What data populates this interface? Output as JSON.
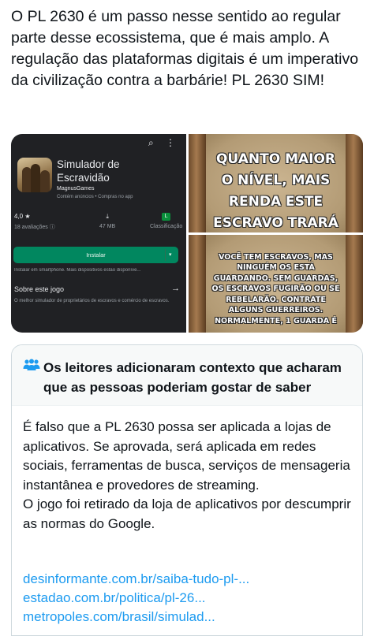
{
  "tweet": {
    "text": "O PL 2630 é um passo nesse sentido ao regular parte desse ecossistema, que é mais amplo. A regulação das plataformas digitais é um imperativo da civilização contra a barbárie! PL 2630 SIM!"
  },
  "media": {
    "playstore": {
      "app_title": "Simulador de Escravidão",
      "developer": "MagnusGames",
      "note": "Contém anúncios • Compras no app",
      "rating_value": "4,0 ★",
      "rating_label": "18 avaliações ⓘ",
      "size_value": "47 MB",
      "classification_badge": "L",
      "classification_label": "Classificação",
      "install_label": "Instalar",
      "availability": "Instalar em smartphone. Mais dispositivos estão disponíve...",
      "about_heading": "Sobre este jogo",
      "about_text": "O melhor simulador de proprietários de escravos e comércio de escravos."
    },
    "panel_top_text": "QUANTO MAIOR O NÍVEL, MAIS RENDA ESTE ESCRAVO TRARÁ",
    "panel_bottom_text": "VOCÊ TEM ESCRAVOS, MAS NINGUÉM OS ESTÁ GUARDANDO. SEM GUARDAS, OS ESCRAVOS FUGIRÃO OU SE REBELARÃO. CONTRATE ALGUNS GUERREIROS. NORMALMENTE, 1 GUARDA É"
  },
  "community_note": {
    "title": "Os leitores adicionaram contexto que acharam que as pessoas poderiam gostar de saber",
    "body_p1": "É falso que a PL 2630 possa ser aplicada a lojas de aplicativos. Se aprovada, será aplicada em redes sociais, ferramentas de busca, serviços de mensageria instantânea e provedores de streaming.",
    "body_p2": "O jogo foi retirado da loja de aplicativos por descumprir as normas do Google.",
    "links": [
      "desinformante.com.br/saiba-tudo-pl-...",
      "estadao.com.br/politica/pl-26...",
      "metropoles.com/brasil/simulad..."
    ]
  },
  "colors": {
    "link": "#1d9bf0",
    "install_green": "#01875f",
    "playstore_bg": "#202124",
    "note_header_bg": "#f7f9f9"
  }
}
